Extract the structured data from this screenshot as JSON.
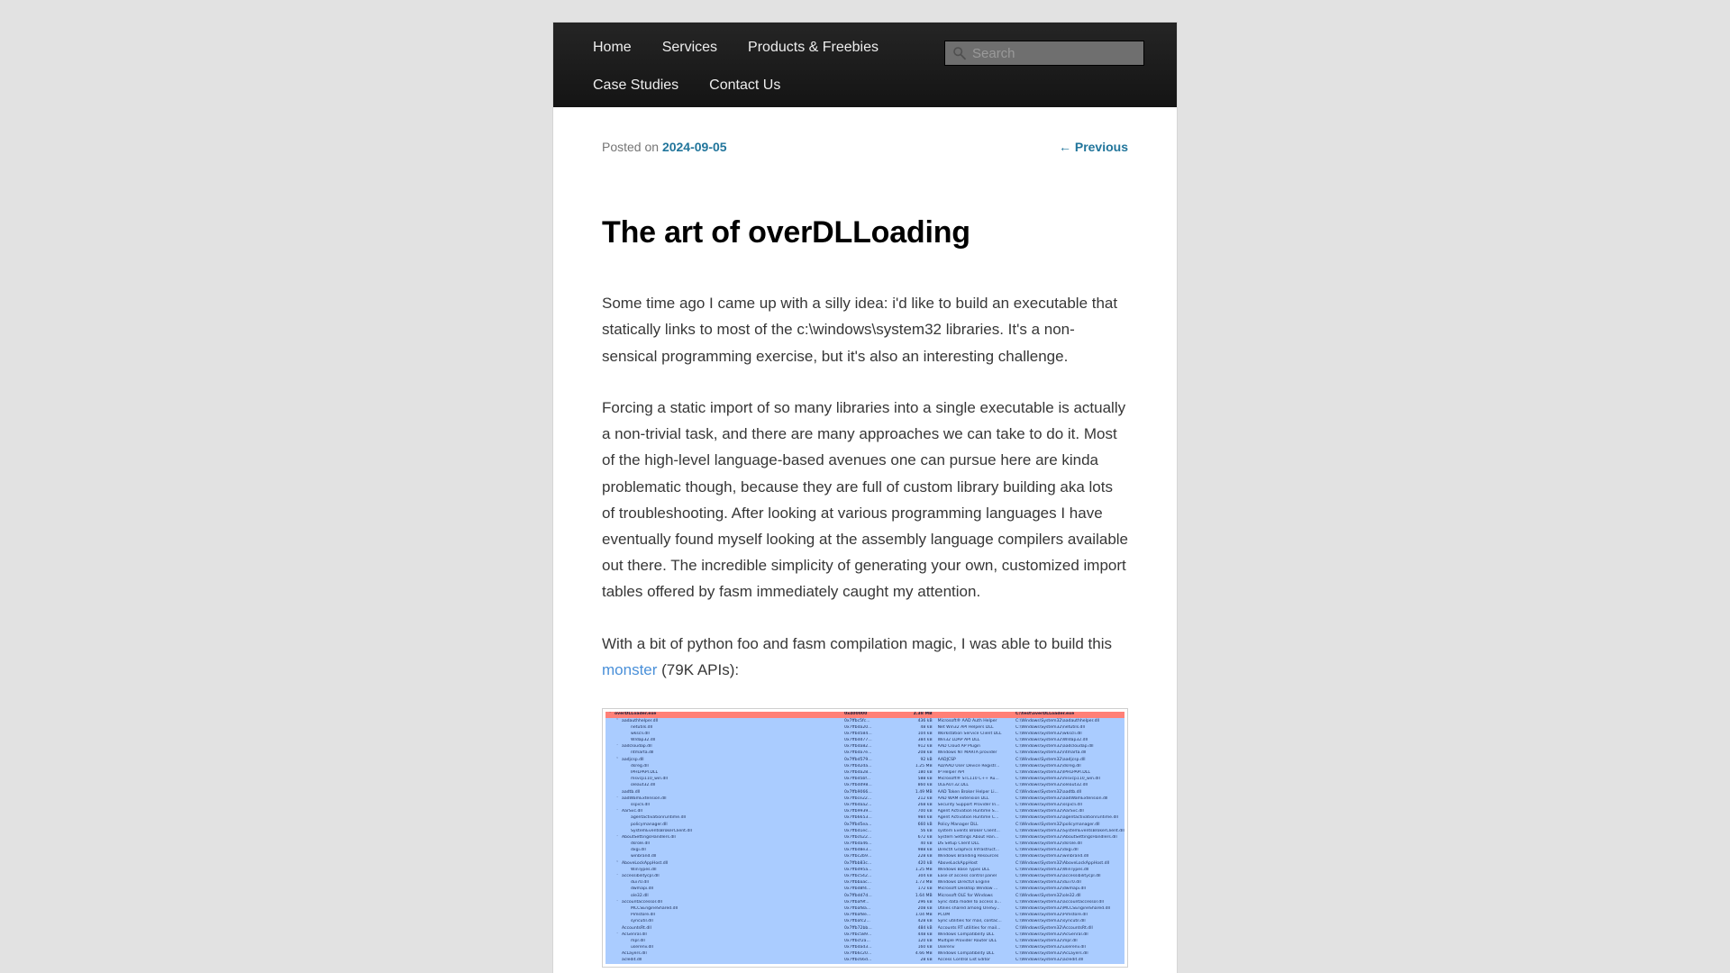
{
  "nav": {
    "rows": [
      [
        {
          "label": "Home",
          "name": "nav-item-home"
        },
        {
          "label": "Services",
          "name": "nav-item-services"
        },
        {
          "label": "Products & Freebies",
          "name": "nav-item-products-freebies"
        }
      ],
      [
        {
          "label": "Case Studies",
          "name": "nav-item-case-studies"
        },
        {
          "label": "Contact Us",
          "name": "nav-item-contact-us"
        }
      ]
    ]
  },
  "search": {
    "placeholder": "Search",
    "value": "",
    "icon": "search-icon"
  },
  "post": {
    "posted_on_label": "Posted on",
    "date": "2024-09-05",
    "previous_label": "← Previous",
    "title": "The art of overDLLoading",
    "paragraphs": [
      "Some time ago I came up with a silly idea: i'd like to build an executable that statically links to most of the c:\\windows\\system32 libraries. It's a non-sensical programming exercise, but it's also an interesting challenge.",
      "Forcing a static import of so many libraries into a single executable is actually a non-trivial task, and there are many approaches we can take to do it. Most of the high-level language-based avenues one can pursue here are kinda problematic though, because they are full of custom library building aka lots of troubleshooting. After looking at various programming languages I have eventually found myself looking at the assembly language compilers available out there. The incredible simplicity of generating your own, customized import tables offered by fasm immediately caught my attention."
    ],
    "link_paragraph": {
      "before": "With a bit of python foo and fasm compilation magic, I was able to build this ",
      "link_text": "monster",
      "after": " (79K APIs):"
    }
  },
  "screenshot": {
    "colors": {
      "root_row": "#ff8077",
      "rows": "#aaccff",
      "text": "#1a2a52"
    },
    "rows": [
      {
        "indent": 0,
        "caret": "v",
        "name": "overDLLoader.exe",
        "addr": "0x400000",
        "size": "2.38 MB",
        "desc": "",
        "path": "C:\\test\\overDLLoader.exe",
        "root": true
      },
      {
        "indent": 1,
        "caret": "v",
        "name": "aadauthhelper.dll",
        "addr": "0x7ffbc5fc...",
        "size": "436 kB",
        "desc": "Microsoft® AAD Auth Helper",
        "path": "C:\\Windows\\System32\\aadauthhelper.dll"
      },
      {
        "indent": 2,
        "caret": "",
        "name": "netutils.dll",
        "addr": "0x7ffbda20...",
        "size": "48 kB",
        "desc": "Net Win32 API Helpers DLL",
        "path": "C:\\Windows\\System32\\netutils.dll"
      },
      {
        "indent": 2,
        "caret": "",
        "name": "wkscli.dll",
        "addr": "0x7ffbd584...",
        "size": "104 kB",
        "desc": "Workstation Service Client DLL",
        "path": "C:\\Windows\\System32\\wkscli.dll"
      },
      {
        "indent": 2,
        "caret": "",
        "name": "Wldap32.dll",
        "addr": "0x7ffbdd77...",
        "size": "384 kB",
        "desc": "Win32 LDAP API DLL",
        "path": "C:\\Windows\\System32\\Wldap32.dll"
      },
      {
        "indent": 1,
        "caret": "v",
        "name": "aadcloudap.dll",
        "addr": "0x7ffbda82...",
        "size": "912 kB",
        "desc": "AAD Cloud AP Plugin",
        "path": "C:\\Windows\\System32\\aadcloudap.dll"
      },
      {
        "indent": 2,
        "caret": "",
        "name": "ntmarta.dll",
        "addr": "0x7ffbda7e...",
        "size": "208 kB",
        "desc": "Windows NT MARTA provider",
        "path": "C:\\Windows\\System32\\ntmarta.dll"
      },
      {
        "indent": 1,
        "caret": "v",
        "name": "aadjcsp.dll",
        "addr": "0x7ffbd579...",
        "size": "92 kB",
        "desc": "AADJCSP",
        "path": "C:\\Windows\\System32\\aadjcsp.dll"
      },
      {
        "indent": 2,
        "caret": "",
        "name": "dsreg.dll",
        "addr": "0x7ffbd2da...",
        "size": "1.25 MB",
        "desc": "AD/AAD User Device Registr...",
        "path": "C:\\Windows\\System32\\dsreg.dll"
      },
      {
        "indent": 2,
        "caret": "",
        "name": "IPHLPAPI.DLL",
        "addr": "0x7ffbda28...",
        "size": "180 kB",
        "desc": "IP Helper API",
        "path": "C:\\Windows\\System32\\IPHLPAPI.DLL"
      },
      {
        "indent": 2,
        "caret": "",
        "name": "msvcp110_win.dll",
        "addr": "0x7ffbd5bf...",
        "size": "588 kB",
        "desc": "Microsoft® STL110 C++ Ru...",
        "path": "C:\\Windows\\System32\\msvcp110_win.dll"
      },
      {
        "indent": 2,
        "caret": "",
        "name": "oleaut32.dll",
        "addr": "0x7ffbdd98...",
        "size": "860 kB",
        "desc": "OLEAUT32.DLL",
        "path": "C:\\Windows\\System32\\oleaut32.dll"
      },
      {
        "indent": 1,
        "caret": "",
        "name": "aadtb.dll",
        "addr": "0x7ffb9066...",
        "size": "1.49 MB",
        "desc": "AAD Token Broker Helper Li...",
        "path": "C:\\Windows\\System32\\aadtb.dll"
      },
      {
        "indent": 1,
        "caret": "v",
        "name": "aadWamExtension.dll",
        "addr": "0x7ffbce22...",
        "size": "212 kB",
        "desc": "AAD WAM extension DLL",
        "path": "C:\\Windows\\System32\\aadWamExtension.dll"
      },
      {
        "indent": 2,
        "caret": "",
        "name": "sspicli.dll",
        "addr": "0x7ffbdaa2...",
        "size": "268 kB",
        "desc": "Security Support Provider In...",
        "path": "C:\\Windows\\System32\\sspicli.dll"
      },
      {
        "indent": 1,
        "caret": "v",
        "name": "AarSvc.dll",
        "addr": "0x7ffb9939...",
        "size": "700 kB",
        "desc": "Agent Activation Runtime S...",
        "path": "C:\\Windows\\System32\\AarSvc.dll"
      },
      {
        "indent": 2,
        "caret": "",
        "name": "agentactivationruntime.dll",
        "addr": "0x7ffb6653...",
        "size": "984 kB",
        "desc": "Agent Activation Runtime C...",
        "path": "C:\\Windows\\System32\\agentactivationruntime.dll"
      },
      {
        "indent": 2,
        "caret": "",
        "name": "policymanager.dll",
        "addr": "0x7ffbd5ea...",
        "size": "660 kB",
        "desc": "Policy Manager DLL",
        "path": "C:\\Windows\\System32\\policymanager.dll"
      },
      {
        "indent": 2,
        "caret": "",
        "name": "SystemEventsBrokerClient.dll",
        "addr": "0x7ffbd1ec...",
        "size": "56 kB",
        "desc": "system Events Broker Client...",
        "path": "C:\\Windows\\System32\\SystemEventsBrokerClient.dll"
      },
      {
        "indent": 1,
        "caret": "v",
        "name": "AboutSettingsHandlers.dll",
        "addr": "0x7ffbc622...",
        "size": "672 kB",
        "desc": "System Settings About Han...",
        "path": "C:\\Windows\\System32\\AboutSettingsHandlers.dll"
      },
      {
        "indent": 2,
        "caret": "",
        "name": "dsrole.dll",
        "addr": "0x7ffbda46...",
        "size": "40 kB",
        "desc": "DS Setup Client DLL",
        "path": "C:\\Windows\\System32\\dsrole.dll"
      },
      {
        "indent": 2,
        "caret": "",
        "name": "dxgi.dll",
        "addr": "0x7ffbd8e3...",
        "size": "988 kB",
        "desc": "DirectX Graphics Infrastruct...",
        "path": "C:\\Windows\\System32\\dxgi.dll"
      },
      {
        "indent": 2,
        "caret": "",
        "name": "winbrand.dll",
        "addr": "0x7ffbc2b9...",
        "size": "228 kB",
        "desc": "Windows Branding Resources",
        "path": "C:\\Windows\\System32\\winbrand.dll"
      },
      {
        "indent": 1,
        "caret": "v",
        "name": "AboveLockAppHost.dll",
        "addr": "0x7ffbb83c...",
        "size": "420 kB",
        "desc": "AboveLockAppHost",
        "path": "C:\\Windows\\System32\\AboveLockAppHost.dll"
      },
      {
        "indent": 2,
        "caret": "",
        "name": "WinTypes.dll",
        "addr": "0x7ffbd95a...",
        "size": "1.25 MB",
        "desc": "Windows Base Types DLL",
        "path": "C:\\Windows\\System32\\WinTypes.dll"
      },
      {
        "indent": 1,
        "caret": "v",
        "name": "accessibilitycpl.dll",
        "addr": "0x7ffbc542...",
        "size": "304 kB",
        "desc": "Ease of access  control panel",
        "path": "C:\\Windows\\System32\\accessibilitycpl.dll"
      },
      {
        "indent": 2,
        "caret": "",
        "name": "dui70.dll",
        "addr": "0x7ffbbaac...",
        "size": "1.73 MB",
        "desc": "Windows DirectUI Engine",
        "path": "C:\\Windows\\System32\\dui70.dll"
      },
      {
        "indent": 2,
        "caret": "",
        "name": "dwmapi.dll",
        "addr": "0x7ffbd8f4...",
        "size": "172 kB",
        "desc": "Microsoft Desktop Window ...",
        "path": "C:\\Windows\\System32\\dwmapi.dll"
      },
      {
        "indent": 2,
        "caret": "",
        "name": "ole32.dll",
        "addr": "0x7ffbdd7d...",
        "size": "1.64 MB",
        "desc": "Microsoft OLE for Windows",
        "path": "C:\\Windows\\System32\\ole32.dll"
      },
      {
        "indent": 1,
        "caret": "v",
        "name": "accountaccessor.dll",
        "addr": "0x7ffbaf9f...",
        "size": "296 kB",
        "desc": "Sync data model to access a...",
        "path": "C:\\Windows\\System32\\accountaccessor.dll"
      },
      {
        "indent": 2,
        "caret": "",
        "name": "MCCSEngineShared.dll",
        "addr": "0x7ffbaf8a...",
        "size": "208 kB",
        "desc": "Utilies shared among OneSy...",
        "path": "C:\\Windows\\System32\\MCCSEngineShared.dll"
      },
      {
        "indent": 2,
        "caret": "",
        "name": "Pimstore.dll",
        "addr": "0x7ffbaf8e...",
        "size": "1.04 MB",
        "desc": "PCOM",
        "path": "C:\\Windows\\System32\\Pimstore.dll"
      },
      {
        "indent": 2,
        "caret": "",
        "name": "syncutil.dll",
        "addr": "0x7ffbafc2...",
        "size": "428 kB",
        "desc": "Sync utilities for mail, contac...",
        "path": "C:\\Windows\\System32\\syncutil.dll"
      },
      {
        "indent": 1,
        "caret": "",
        "name": "AccountsRt.dll",
        "addr": "0x7ffb72bb...",
        "size": "484 kB",
        "desc": "Accounts RT utilities for mail...",
        "path": "C:\\Windows\\System32\\AccountsRt.dll"
      },
      {
        "indent": 1,
        "caret": "v",
        "name": "AcGenral.dll",
        "addr": "0x7ffbc589...",
        "size": "448 kB",
        "desc": "Windows Compatibility DLL",
        "path": "C:\\Windows\\System32\\AcGenral.dll"
      },
      {
        "indent": 2,
        "caret": "",
        "name": "mpr.dll",
        "addr": "0x7ffbcf2a...",
        "size": "120 kB",
        "desc": "Multiple Provider Router DLL",
        "path": "C:\\Windows\\System32\\mpr.dll"
      },
      {
        "indent": 2,
        "caret": "",
        "name": "userenv.dll",
        "addr": "0x7ffbdad3...",
        "size": "160 kB",
        "desc": "Userenv",
        "path": "C:\\Windows\\System32\\userenv.dll"
      },
      {
        "indent": 1,
        "caret": "",
        "name": "AcLayers.dll",
        "addr": "0x7ffb6c20...",
        "size": "4.66 MB",
        "desc": "Windows Compatibility DLL",
        "path": "C:\\Windows\\System32\\AcLayers.dll"
      },
      {
        "indent": 1,
        "caret": "",
        "name": "acledit.dll",
        "addr": "0x7ffbc66d...",
        "size": "28 kB",
        "desc": "Access Control List Editor",
        "path": "C:\\Windows\\System32\\acledit.dll"
      }
    ]
  }
}
